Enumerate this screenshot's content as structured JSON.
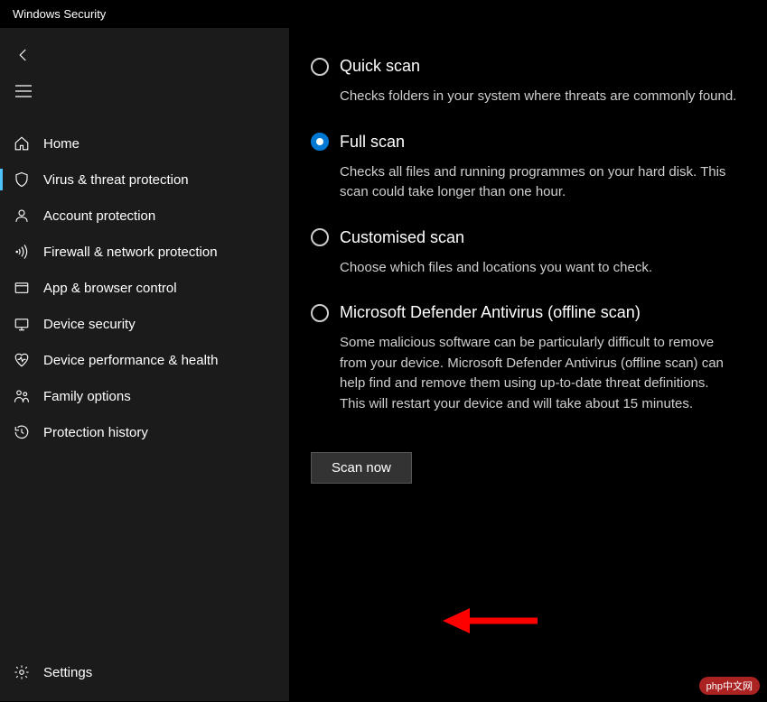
{
  "window": {
    "title": "Windows Security"
  },
  "sidebar": {
    "items": [
      {
        "icon": "home-icon",
        "label": "Home"
      },
      {
        "icon": "shield-icon",
        "label": "Virus & threat protection",
        "active": true
      },
      {
        "icon": "account-icon",
        "label": "Account protection"
      },
      {
        "icon": "firewall-icon",
        "label": "Firewall & network protection"
      },
      {
        "icon": "browser-icon",
        "label": "App & browser control"
      },
      {
        "icon": "device-icon",
        "label": "Device security"
      },
      {
        "icon": "heart-icon",
        "label": "Device performance & health"
      },
      {
        "icon": "family-icon",
        "label": "Family options"
      },
      {
        "icon": "history-icon",
        "label": "Protection history"
      }
    ],
    "settings": {
      "icon": "gear-icon",
      "label": "Settings"
    }
  },
  "scan_options": [
    {
      "id": "quick",
      "title": "Quick scan",
      "desc": "Checks folders in your system where threats are commonly found.",
      "selected": false
    },
    {
      "id": "full",
      "title": "Full scan",
      "desc": "Checks all files and running programmes on your hard disk. This scan could take longer than one hour.",
      "selected": true
    },
    {
      "id": "custom",
      "title": "Customised scan",
      "desc": "Choose which files and locations you want to check.",
      "selected": false
    },
    {
      "id": "offline",
      "title": "Microsoft Defender Antivirus (offline scan)",
      "desc": "Some malicious software can be particularly difficult to remove from your device. Microsoft Defender Antivirus (offline scan) can help find and remove them using up-to-date threat definitions. This will restart your device and will take about 15 minutes.",
      "selected": false
    }
  ],
  "scan_button": {
    "label": "Scan now"
  },
  "watermark": "php中文网"
}
